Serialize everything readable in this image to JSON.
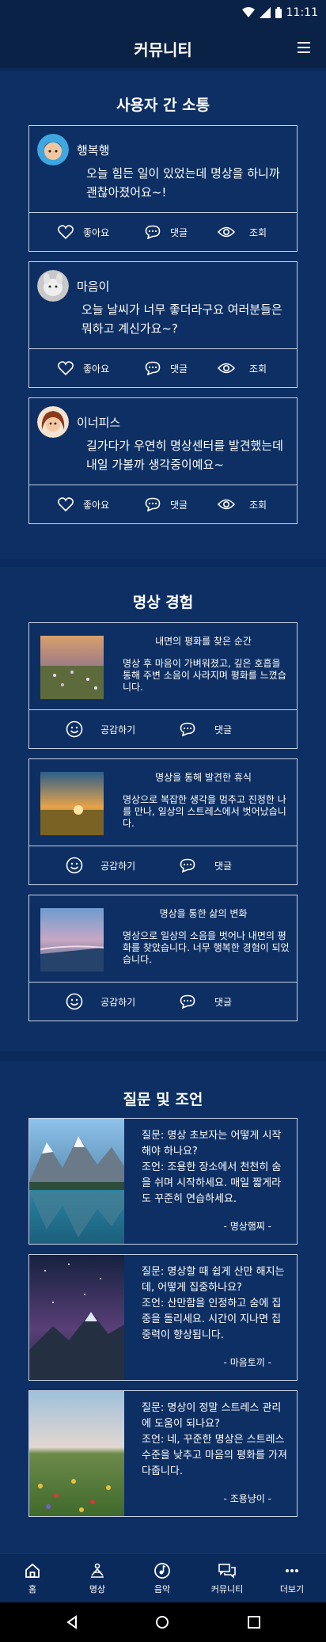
{
  "status_bar": {
    "time": "11:11"
  },
  "header": {
    "title": "커뮤니티"
  },
  "communication": {
    "title": "사용자 간 소통",
    "posts": [
      {
        "user": "행복행",
        "text": "오늘 힘든 일이 있었는데 명상을 하니까 괜찮아졌어요~!"
      },
      {
        "user": "마음이",
        "text": "오늘 날씨가 너무 좋더라구요 여러분들은 뭐하고 계신가요~?"
      },
      {
        "user": "이너피스",
        "text": "길가다가 우연히 명상센터를 발견했는데 내일 가볼까 생각중이예요~"
      }
    ],
    "like_label": "좋아요",
    "comment_label": "댓글",
    "view_label": "조회"
  },
  "experience": {
    "title": "명상 경험",
    "items": [
      {
        "title": "내면의 평화를 찾은 순간",
        "body": "명상 후 마음이 가벼워졌고, 깊은 호흡을 통해 주변 소음이 사라지며 평화를 느꼈습니다."
      },
      {
        "title": "명상을 통해 발견한 휴식",
        "body": "명상으로 복잡한 생각을 멈추고 진정한 나를 만나, 일상의 스트레스에서 벗어났습니다."
      },
      {
        "title": "명상을 통한 삶의 변화",
        "body": "명상으로 일상의 소음을 벗어나 내면의 평화를 찾았습니다. 너무 행복한 경험이 되었습니다."
      }
    ],
    "empathy_label": "공감하기",
    "comment_label": "댓글"
  },
  "qa": {
    "title": "질문 및 조언",
    "items": [
      {
        "text": "질문: 명상 초보자는 어떻게 시작해야 하나요?\n조언: 조용한 장소에서 천천히 숨을 쉬며 시작하세요. 매일 짧게라도 꾸준히 연습하세요.",
        "author": "- 명상햄찌 -"
      },
      {
        "text": "질문: 명상할 때 쉽게 산만 해지는데, 어떻게 집중하나요?\n조언: 산만함을 인정하고 숨에 집중을 돌리세요. 시간이 지나면 집중력이 향상됩니다.",
        "author": "- 마음토끼 -"
      },
      {
        "text": "질문: 명상이 정말 스트레스 관리에 도움이 되나요?\n조언: 네, 꾸준한 명상은 스트레스 수준을 낮추고 마음의 평화를 가져다줍니다.",
        "author": "- 조용냥이 -"
      }
    ]
  },
  "bottom_nav": [
    {
      "label": "홈",
      "icon": "home-icon"
    },
    {
      "label": "명상",
      "icon": "meditation-icon"
    },
    {
      "label": "음악",
      "icon": "music-icon"
    },
    {
      "label": "커뮤니티",
      "icon": "community-icon"
    },
    {
      "label": "더보기",
      "icon": "more-icon"
    }
  ]
}
